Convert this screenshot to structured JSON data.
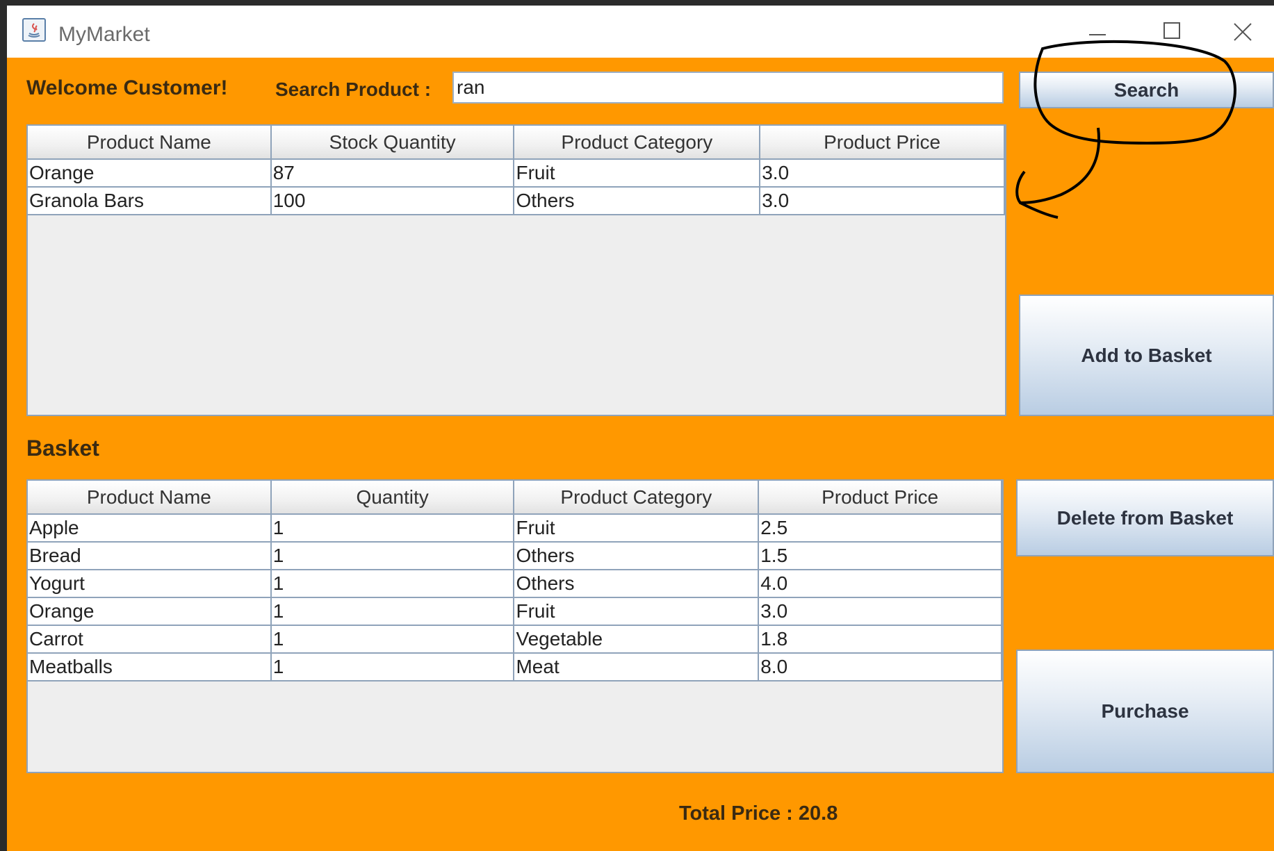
{
  "window": {
    "title": "MyMarket"
  },
  "header": {
    "welcome": "Welcome Customer!",
    "search_label": "Search Product :",
    "search_value": "ran",
    "search_button": "Search"
  },
  "products_table": {
    "columns": [
      "Product Name",
      "Stock Quantity",
      "Product Category",
      "Product Price"
    ],
    "rows": [
      [
        "Orange",
        "87",
        "Fruit",
        "3.0"
      ],
      [
        "Granola Bars",
        "100",
        "Others",
        "3.0"
      ]
    ]
  },
  "actions": {
    "add_to_basket": "Add to Basket",
    "delete_from_basket": "Delete from Basket",
    "purchase": "Purchase"
  },
  "basket": {
    "title": "Basket",
    "columns": [
      "Product Name",
      "Quantity",
      "Product Category",
      "Product Price"
    ],
    "rows": [
      [
        "Apple",
        "1",
        "Fruit",
        "2.5"
      ],
      [
        "Bread",
        "1",
        "Others",
        "1.5"
      ],
      [
        "Yogurt",
        "1",
        "Others",
        "4.0"
      ],
      [
        "Orange",
        "1",
        "Fruit",
        "3.0"
      ],
      [
        "Carrot",
        "1",
        "Vegetable",
        "1.8"
      ],
      [
        "Meatballs",
        "1",
        "Meat",
        "8.0"
      ]
    ]
  },
  "footer": {
    "total_price": "Total Price : 20.8"
  },
  "colors": {
    "background": "#ff9800",
    "label_text": "#3a2a12",
    "annotation_ink": "#000000"
  }
}
